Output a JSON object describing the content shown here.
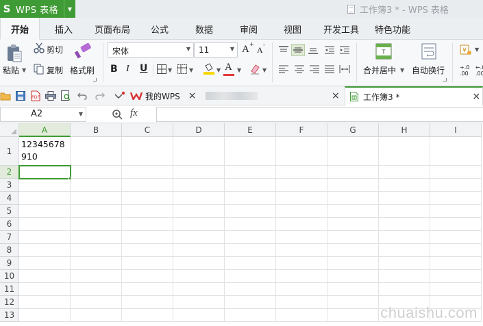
{
  "app": {
    "name": "WPS 表格",
    "logo": "S"
  },
  "window": {
    "title": "工作簿3 * - WPS 表格"
  },
  "menu": {
    "tabs": [
      "开始",
      "插入",
      "页面布局",
      "公式",
      "数据",
      "审阅",
      "视图",
      "开发工具",
      "特色功能"
    ]
  },
  "ribbon": {
    "paste_label": "粘贴",
    "cut_label": "剪切",
    "copy_label": "复制",
    "format_painter_label": "格式刷",
    "font_name": "宋体",
    "font_size": "11",
    "grow_font": "A",
    "shrink_font": "A",
    "bold": "B",
    "italic": "I",
    "underline": "U",
    "font_color_glyph": "A",
    "merge_center_label": "合并居中",
    "wrap_text_label": "自动换行",
    "increase_decimal": "+.0\n.00",
    "decrease_decimal": "←.0\n.00"
  },
  "doc_tabs": [
    {
      "label": "我的WPS"
    },
    {
      "label": "工作簿3 *"
    }
  ],
  "formula_bar": {
    "name_box": "A2",
    "fx_label": "fx",
    "value": ""
  },
  "sheet": {
    "columns": [
      "A",
      "B",
      "C",
      "D",
      "E",
      "F",
      "G",
      "H",
      "I"
    ],
    "rows": [
      "1",
      "2",
      "3",
      "4",
      "5",
      "6",
      "7",
      "8",
      "9",
      "10",
      "11",
      "12",
      "13"
    ],
    "selected_cell": "A2",
    "cells": {
      "A1": "12345678\n910"
    }
  },
  "watermark": "chuaishu.com",
  "colors": {
    "accent": "#3f9b35",
    "font_color": "#e23b3b",
    "fill_color": "#f5d800"
  }
}
